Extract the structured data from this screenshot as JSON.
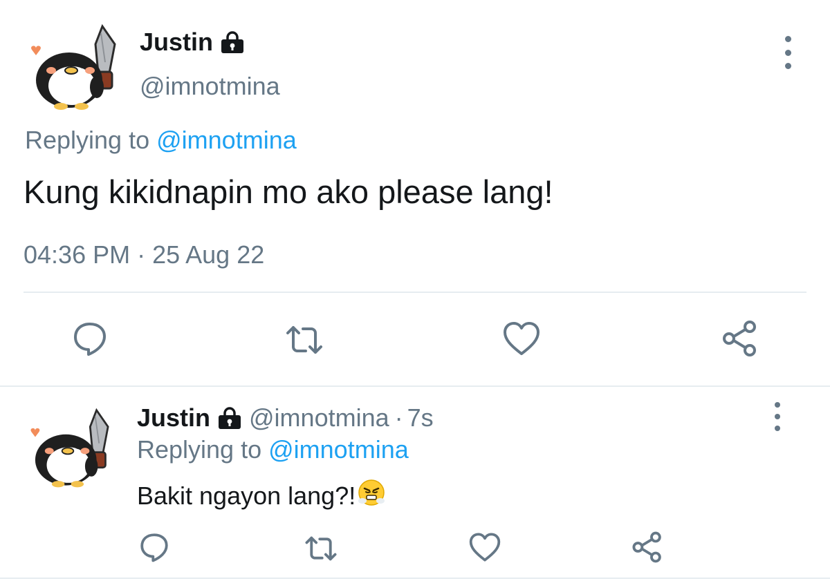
{
  "main_tweet": {
    "name": "Justin",
    "handle": "@imnotmina",
    "reply_prefix": "Replying to",
    "reply_to": "@imnotmina",
    "text": "Kung kikidnapin mo ako please lang!",
    "timestamp": "04:36 PM · 25 Aug 22",
    "icons": [
      "lock-icon",
      "more-options-icon",
      "reply-icon",
      "retweet-icon",
      "like-icon",
      "share-icon"
    ]
  },
  "reply_tweet": {
    "name": "Justin",
    "handle": "@imnotmina",
    "separator": "·",
    "age": "7s",
    "reply_prefix": "Replying to",
    "reply_to": "@imnotmina",
    "text": "Bakit ngayon lang?!",
    "emoji": "😤",
    "icons": [
      "lock-icon",
      "more-options-icon",
      "reply-icon",
      "retweet-icon",
      "like-icon",
      "share-icon"
    ]
  },
  "colors": {
    "accent": "#1da1f2",
    "muted": "#657786",
    "text": "#14171a",
    "divider": "#e6ecf0",
    "icon": "#657786"
  }
}
